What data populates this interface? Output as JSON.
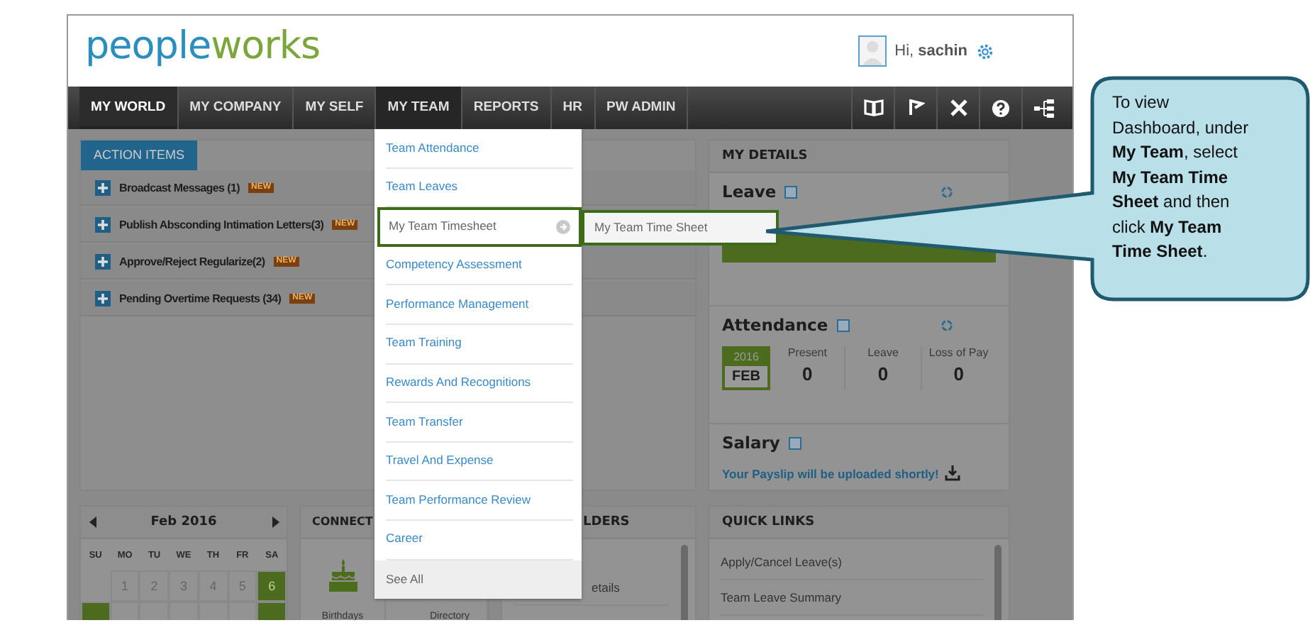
{
  "header": {
    "logo": "peopleworks",
    "greeting": "Hi, **sachin**"
  },
  "nav": [
    {
      "label": "MY WORLD",
      "selected": true,
      "expanded": false
    },
    {
      "label": "MY COMPANY",
      "selected": false,
      "expanded": false
    },
    {
      "label": "MY SELF",
      "selected": false,
      "expanded": false
    },
    {
      "label": "MY TEAM",
      "selected": false,
      "expanded": true
    },
    {
      "label": "REPORTS",
      "selected": false,
      "expanded": false
    },
    {
      "label": "HR",
      "selected": false,
      "expanded": false
    },
    {
      "label": "PW ADMIN",
      "selected": false,
      "expanded": false
    }
  ],
  "action_items": {
    "tab": "ACTION ITEMS",
    "rows": [
      {
        "label": "Broadcast Messages (1)",
        "badge": "NEW"
      },
      {
        "label": "Publish Absconding Intimation Letters(3)",
        "badge": "NEW"
      },
      {
        "label": "Approve/Reject Regularize(2)",
        "badge": "NEW"
      },
      {
        "label": "Pending Overtime Requests (34)",
        "badge": "NEW"
      }
    ]
  },
  "my_details": {
    "title": "MY DETAILS",
    "leave": {
      "title": "Leave"
    },
    "attendance": {
      "title": "Attendance",
      "year": "2016",
      "month": "FEB",
      "stats": [
        {
          "label": "Present",
          "value": "0"
        },
        {
          "label": "Leave",
          "value": "0"
        },
        {
          "label": "Loss of Pay",
          "value": "0"
        }
      ]
    },
    "salary": {
      "title": "Salary",
      "note": "Your Payslip will be uploaded shortly!"
    }
  },
  "calendar": {
    "month": "Feb 2016",
    "weekdays": [
      "SU",
      "MO",
      "TU",
      "WE",
      "TH",
      "FR",
      "SA"
    ],
    "weeks": [
      [
        {
          "day": "1",
          "highlighted": false
        },
        {
          "day": "2",
          "highlighted": false
        },
        {
          "day": "3",
          "highlighted": false
        },
        {
          "day": "4",
          "highlighted": false
        },
        {
          "day": "5",
          "highlighted": false
        },
        {
          "day": "6",
          "highlighted": true
        }
      ],
      [
        {
          "highlighted": true
        },
        {
          "highlighted": false
        },
        {
          "highlighted": false
        },
        {
          "highlighted": false
        },
        {
          "highlighted": false
        },
        {
          "highlighted": false
        },
        {
          "highlighted": true
        }
      ]
    ]
  },
  "connect": {
    "title": "CONNECT",
    "items": [
      {
        "kind": "birthdays",
        "label": "Birthdays"
      },
      {
        "kind": "directory",
        "label": "Directory"
      }
    ]
  },
  "reminders": {
    "title": "LDERS",
    "items": [
      "etails"
    ]
  },
  "quick_links": {
    "title": "QUICK LINKS",
    "items": [
      "Apply/Cancel Leave(s)",
      "Team Leave Summary"
    ]
  },
  "menu": {
    "items": [
      {
        "label": "Team Attendance",
        "kind": "link",
        "selected": false
      },
      {
        "label": "Team Leaves",
        "kind": "link",
        "selected": false
      },
      {
        "label": "My Team Timesheet",
        "kind": "submenu",
        "selected": true
      },
      {
        "label": "Competency Assessment",
        "kind": "link",
        "selected": false
      },
      {
        "label": "Performance Management",
        "kind": "link",
        "selected": false
      },
      {
        "label": "Team Training",
        "kind": "link",
        "selected": false
      },
      {
        "label": "Rewards And Recognitions",
        "kind": "link",
        "selected": false
      },
      {
        "label": "Team Transfer",
        "kind": "link",
        "selected": false
      },
      {
        "label": "Travel And Expense",
        "kind": "link",
        "selected": false
      },
      {
        "label": "Team Performance Review",
        "kind": "link",
        "selected": false
      },
      {
        "label": "Career",
        "kind": "link",
        "selected": false
      },
      {
        "label": "See All",
        "kind": "footer",
        "selected": false
      }
    ],
    "submenu": [
      {
        "label": "My Team Time Sheet",
        "selected": true
      }
    ]
  },
  "callout": "To view Dashboard, under **My Team**, select **My Team Time Sheet** and then click **My Team Time Sheet**."
}
